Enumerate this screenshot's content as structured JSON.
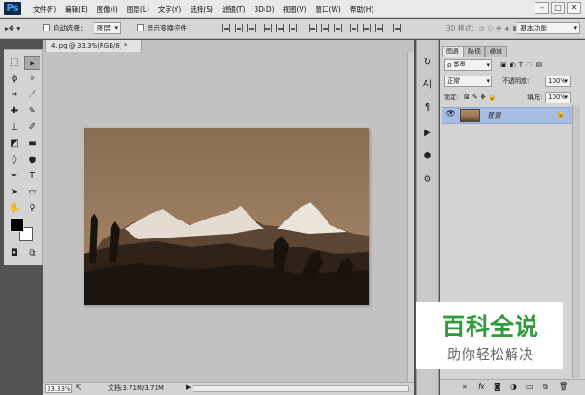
{
  "app": {
    "logo": "Ps"
  },
  "menu": [
    "文件(F)",
    "编辑(E)",
    "图像(I)",
    "图层(L)",
    "文字(Y)",
    "选择(S)",
    "滤镜(T)",
    "3D(D)",
    "视图(V)",
    "窗口(W)",
    "帮助(H)"
  ],
  "window_controls": {
    "minimize": "–",
    "restore": "□",
    "close": "✕"
  },
  "options": {
    "auto_select_label": "自动选择：",
    "auto_select_value": "图层",
    "show_transform_label": "显示变换控件",
    "mode_3d_label": "3D 模式：",
    "workspace_value": "基本功能"
  },
  "document": {
    "tab_title": "4.jpg @ 33.3%(RGB/8) *",
    "zoom": "33.33%",
    "doc_info": "文档:3.71M/3.71M"
  },
  "panels": {
    "tabs": [
      "图层",
      "路径",
      "通道"
    ],
    "kind_filter": "ρ 类型",
    "blend_mode": "正常",
    "opacity_label": "不透明度:",
    "opacity_value": "100%",
    "lock_label": "锁定:",
    "fill_label": "填充:",
    "fill_value": "100%",
    "layer_name": "背景",
    "footer_icons": [
      "link-icon",
      "fx-icon",
      "mask-icon",
      "adjustment-icon",
      "folder-icon",
      "new-layer-icon",
      "trash-icon"
    ]
  },
  "tool_icons": [
    "marquee-icon",
    "move-icon",
    "lasso-icon",
    "magic-wand-icon",
    "crop-icon",
    "eyedropper-icon",
    "healing-icon",
    "brush-icon",
    "stamp-icon",
    "history-brush-icon",
    "eraser-icon",
    "gradient-icon",
    "blur-icon",
    "dodge-icon",
    "pen-icon",
    "type-icon",
    "path-select-icon",
    "shape-icon",
    "hand-icon",
    "zoom-icon"
  ],
  "watermark": {
    "title": "百科全说",
    "subtitle": "助你轻松解决"
  }
}
